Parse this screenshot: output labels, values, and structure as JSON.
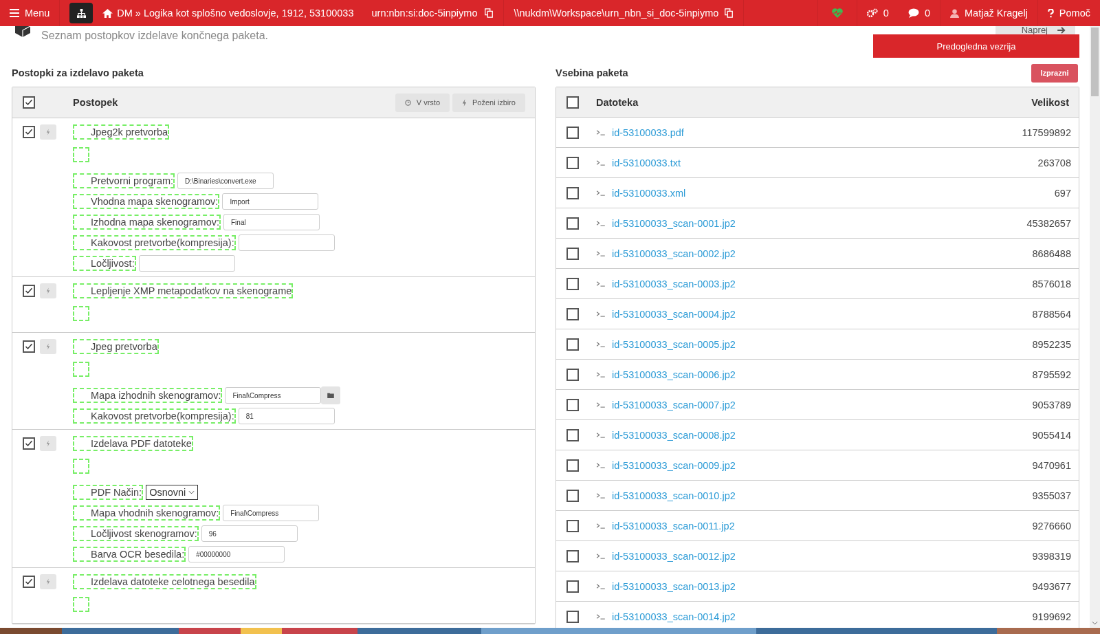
{
  "navbar": {
    "menu": "Menu",
    "breadcrumb": "DM » Logika kot splošno vedoslovje, 1912, 53100033",
    "urn": "urn:nbn:si:doc-5inpiymo",
    "path": "\\\\nukdm\\Workspace\\urn_nbn_si_doc-5inpiymo",
    "jobs_count": "0",
    "messages_count": "0",
    "user": "Matjaž Kragelj",
    "help": "Pomoč"
  },
  "header": {
    "subtitle": "Seznam postopkov izdelave končnega paketa.",
    "next_button": "Naprej",
    "preview_button": "Predogledna vezrija"
  },
  "procedures_panel": {
    "title": "Postopki za izdelavo paketa",
    "all_checked": true,
    "column": "Postopek",
    "queue_button": "V vrsto",
    "run_button": "Poženi izbiro",
    "procedures": [
      {
        "checked": true,
        "title": "Jpeg2k pretvorba",
        "params": [
          {
            "kind": "text",
            "label": "Pretvorni program:",
            "value": "D:\\Binaries\\convert.exe"
          },
          {
            "kind": "text",
            "label": "Vhodna mapa skenogramov:",
            "value": "Import"
          },
          {
            "kind": "text",
            "label": "Izhodna mapa skenogramov:",
            "value": "Final"
          },
          {
            "kind": "text",
            "label": "Kakovost pretvorbe(kompresija):"
          },
          {
            "kind": "text",
            "label": "Ločljivost:"
          }
        ]
      },
      {
        "checked": true,
        "title": "Lepljenje XMP metapodatkov na skenograme"
      },
      {
        "checked": true,
        "title": "Jpeg pretvorba",
        "params": [
          {
            "kind": "folder",
            "label": "Mapa izhodnih skenogramov:",
            "value": "Final\\Compress"
          },
          {
            "kind": "text",
            "label": "Kakovost pretvorbe(kompresija):",
            "value": "81"
          }
        ]
      },
      {
        "checked": true,
        "title": "Izdelava PDF datoteke",
        "params": [
          {
            "kind": "select",
            "label": "PDF Način:",
            "value": "Osnovni"
          },
          {
            "kind": "text",
            "label": "Mapa vhodnih skenogramov:",
            "value": "Final\\Compress"
          },
          {
            "kind": "text",
            "label": "Ločljivost skenogramov:",
            "value": "96"
          },
          {
            "kind": "text",
            "label": "Barva OCR besedila:",
            "value": "#00000000"
          }
        ]
      },
      {
        "checked": true,
        "title": "Izdelava datoteke celotnega besedila"
      }
    ]
  },
  "files_panel": {
    "title": "Vsebina paketa",
    "clear_button": "Izprazni",
    "all_checked": false,
    "columns": [
      "Datoteka",
      "Velikost"
    ],
    "files": [
      {
        "checked": false,
        "name": "id-53100033.pdf",
        "size": "117599892"
      },
      {
        "checked": false,
        "name": "id-53100033.txt",
        "size": "263708"
      },
      {
        "checked": false,
        "name": "id-53100033.xml",
        "size": "697"
      },
      {
        "checked": false,
        "name": "id-53100033_scan-0001.jp2",
        "size": "45382657"
      },
      {
        "checked": false,
        "name": "id-53100033_scan-0002.jp2",
        "size": "8686488"
      },
      {
        "checked": false,
        "name": "id-53100033_scan-0003.jp2",
        "size": "8576018"
      },
      {
        "checked": false,
        "name": "id-53100033_scan-0004.jp2",
        "size": "8788564"
      },
      {
        "checked": false,
        "name": "id-53100033_scan-0005.jp2",
        "size": "8952235"
      },
      {
        "checked": false,
        "name": "id-53100033_scan-0006.jp2",
        "size": "8795592"
      },
      {
        "checked": false,
        "name": "id-53100033_scan-0007.jp2",
        "size": "9053789"
      },
      {
        "checked": false,
        "name": "id-53100033_scan-0008.jp2",
        "size": "9055414"
      },
      {
        "checked": false,
        "name": "id-53100033_scan-0009.jp2",
        "size": "9470961"
      },
      {
        "checked": false,
        "name": "id-53100033_scan-0010.jp2",
        "size": "9355037"
      },
      {
        "checked": false,
        "name": "id-53100033_scan-0011.jp2",
        "size": "9276660"
      },
      {
        "checked": false,
        "name": "id-53100033_scan-0012.jp2",
        "size": "9398319"
      },
      {
        "checked": false,
        "name": "id-53100033_scan-0013.jp2",
        "size": "9493677"
      },
      {
        "checked": false,
        "name": "id-53100033_scan-0014.jp2",
        "size": "9199692"
      }
    ]
  }
}
